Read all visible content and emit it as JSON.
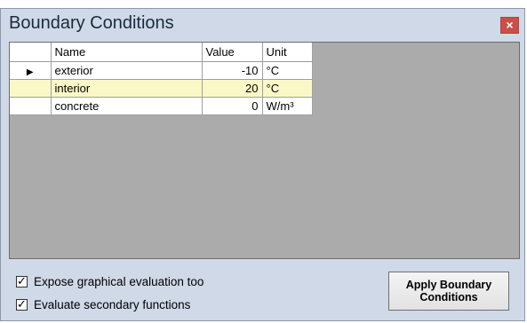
{
  "window": {
    "title": "Boundary Conditions",
    "close_glyph": "×"
  },
  "grid": {
    "columns": {
      "name": "Name",
      "value": "Value",
      "unit": "Unit"
    },
    "current_row_indicator": "▶",
    "rows": [
      {
        "name": "exterior",
        "value": "-10",
        "unit": "°C",
        "selected": false,
        "current": true
      },
      {
        "name": "interior",
        "value": "20",
        "unit": "°C",
        "selected": true,
        "current": false
      },
      {
        "name": "concrete",
        "value": "0",
        "unit": "W/m³",
        "selected": false,
        "current": false
      }
    ]
  },
  "options": {
    "expose_graphical": {
      "label": "Expose graphical evaluation too",
      "checked": true
    },
    "evaluate_secondary": {
      "label": "Evaluate secondary functions",
      "checked": true
    }
  },
  "apply_button": {
    "label": "Apply Boundary Conditions"
  },
  "colors": {
    "window_bg": "#cfd9e7",
    "grid_empty_bg": "#ababab",
    "selected_row_bg": "#fbf8c8",
    "close_button_bg": "#c94f49"
  },
  "icons": {
    "close": "close-icon",
    "check": "checkmark-icon",
    "row_pointer": "row-pointer-icon"
  }
}
